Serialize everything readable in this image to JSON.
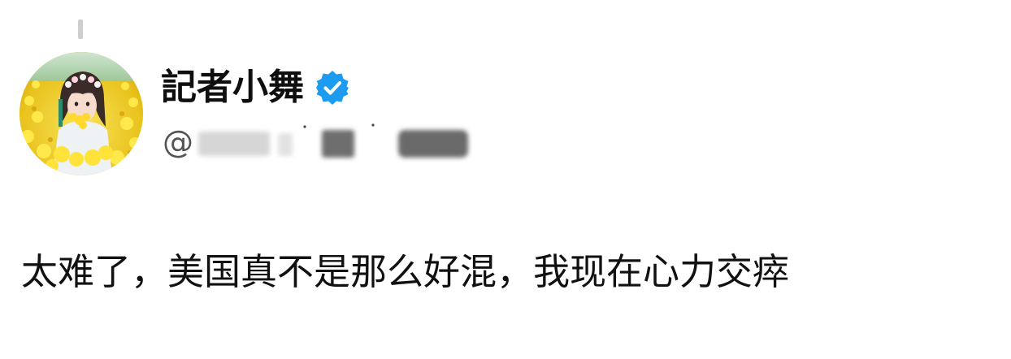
{
  "profile": {
    "display_name": "記者小舞",
    "verified": true,
    "handle_prefix": "@",
    "avatar_icon": "profile-photo",
    "badge_color": "#1d9bf0"
  },
  "post": {
    "text": "太难了，美国真不是那么好混，我现在心力交瘁"
  }
}
